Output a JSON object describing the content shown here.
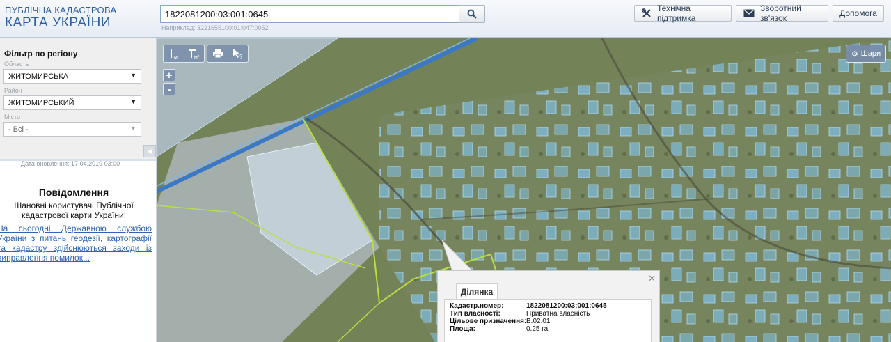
{
  "header": {
    "logo_line1": "ПУБЛІЧНА КАДАСТРОВА",
    "logo_line2": "КАРТА УКРАЇНИ",
    "search": {
      "value": "1822081200:03:001:0645",
      "example": "Наприклад: 3221655100:01:047:0052"
    },
    "support_label": "Технічна підтримка",
    "feedback_label": "Зворотний зв'язок",
    "help_label": "Допомога"
  },
  "sidebar": {
    "filter_title": "Фільтр по регіону",
    "region_label": "Область",
    "region_value": "ЖИТОМИРСЬКА",
    "district_label": "Район",
    "district_value": "ЖИТОМИРСЬКИЙ",
    "city_label": "Місто",
    "city_value": "- Всі -",
    "update_date": "Дата оновлення: 17.04.2019 03:00",
    "notice_title": "Повідомлення",
    "notice_subtitle": "Шановні користувачі Публічної кадастрової карти України!",
    "notice_link": "На сьогодні Державною службою України з питань геодезії, картографії та кадастру здійснюються заходи із виправлення помилок..."
  },
  "map": {
    "zoom_in": "+",
    "zoom_out": "-",
    "layers_label": "Шари",
    "tools": [
      "measure-length-icon",
      "measure-area-icon",
      "print-icon",
      "info-pointer-icon"
    ]
  },
  "popup": {
    "tab_label": "Ділянка",
    "rows": [
      {
        "key": "Кадастр.номер:",
        "value": "1822081200:03:001:0645"
      },
      {
        "key": "Тип власності:",
        "value": "Приватна власність"
      },
      {
        "key": "Цільове призначення:",
        "value": "В.02.01"
      },
      {
        "key": "Площа:",
        "value": "0.25 га"
      }
    ]
  },
  "colors": {
    "brand": "#2f5fa3",
    "parcel_fill": "#8ec9f5",
    "boundary": "#b6e045"
  }
}
